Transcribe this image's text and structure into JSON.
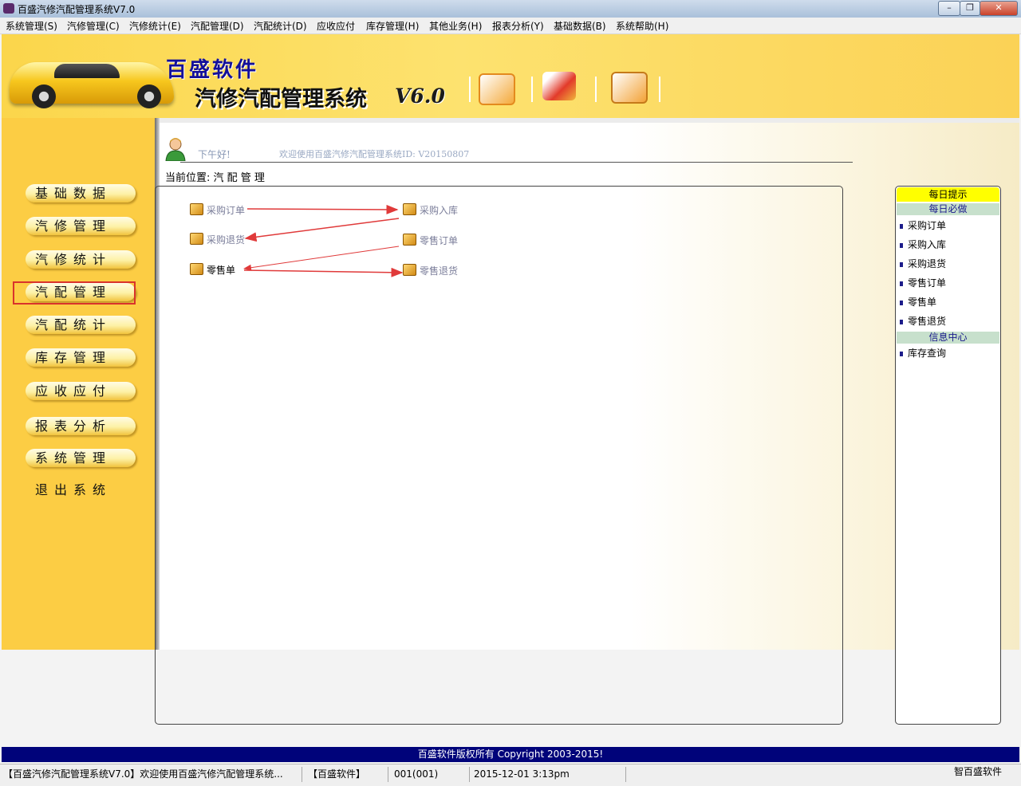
{
  "window": {
    "title": "百盛汽修汽配管理系统V7.0"
  },
  "menu": [
    {
      "label": "系统管理(S)"
    },
    {
      "label": "汽修管理(C)"
    },
    {
      "label": "汽修统计(E)"
    },
    {
      "label": "汽配管理(D)"
    },
    {
      "label": "汽配统计(D)"
    },
    {
      "label": "应收应付"
    },
    {
      "label": "库存管理(H)"
    },
    {
      "label": "其他业务(H)"
    },
    {
      "label": "报表分析(Y)"
    },
    {
      "label": "基础数据(B)"
    },
    {
      "label": "系统帮助(H)"
    }
  ],
  "banner": {
    "brand": "百盛软件",
    "system_name": "汽修汽配管理系统",
    "version": "V6.0"
  },
  "nav": {
    "items": [
      {
        "label": "基础数据"
      },
      {
        "label": "汽修管理"
      },
      {
        "label": "汽修统计"
      },
      {
        "label": "汽配管理"
      },
      {
        "label": "汽配统计"
      },
      {
        "label": "库存管理"
      },
      {
        "label": "应收应付"
      },
      {
        "label": "报表分析"
      },
      {
        "label": "系统管理"
      }
    ],
    "exit_label": "退出系统",
    "selected": "汽配管理"
  },
  "header": {
    "greeting": "下午好!",
    "welcome": "欢迎使用百盛汽修汽配管理系统ID: V20150807",
    "location_label": "当前位置: 汽 配 管 理"
  },
  "flow": {
    "purchase_order": "采购订单",
    "purchase_in": "采购入库",
    "purchase_return": "采购退货",
    "retail_order": "零售订单",
    "retail_sale": "零售单",
    "retail_return": "零售退货"
  },
  "right_panel": {
    "title": "每日提示",
    "daily_section": "每日必做",
    "daily_items": [
      {
        "label": "采购订单"
      },
      {
        "label": "采购入库"
      },
      {
        "label": "采购退货"
      },
      {
        "label": "零售订单"
      },
      {
        "label": "零售单"
      },
      {
        "label": "零售退货"
      }
    ],
    "info_section": "信息中心",
    "info_items": [
      {
        "label": "库存查询"
      }
    ]
  },
  "copyright": "百盛软件版权所有 Copyright 2003-2015!",
  "status": {
    "app": "【百盛汽修汽配管理系统V7.0】欢迎使用百盛汽修汽配管理系统...",
    "company": "【百盛软件】",
    "user": "001(001)",
    "datetime": "2015-12-01 3:13pm",
    "right": "智百盛软件"
  },
  "colors": {
    "accent": "#fccd44",
    "banner": "#fde26f",
    "copyright_bg": "#00037a",
    "arrow": "#e03a3a",
    "selected_frame": "#d9332c"
  }
}
